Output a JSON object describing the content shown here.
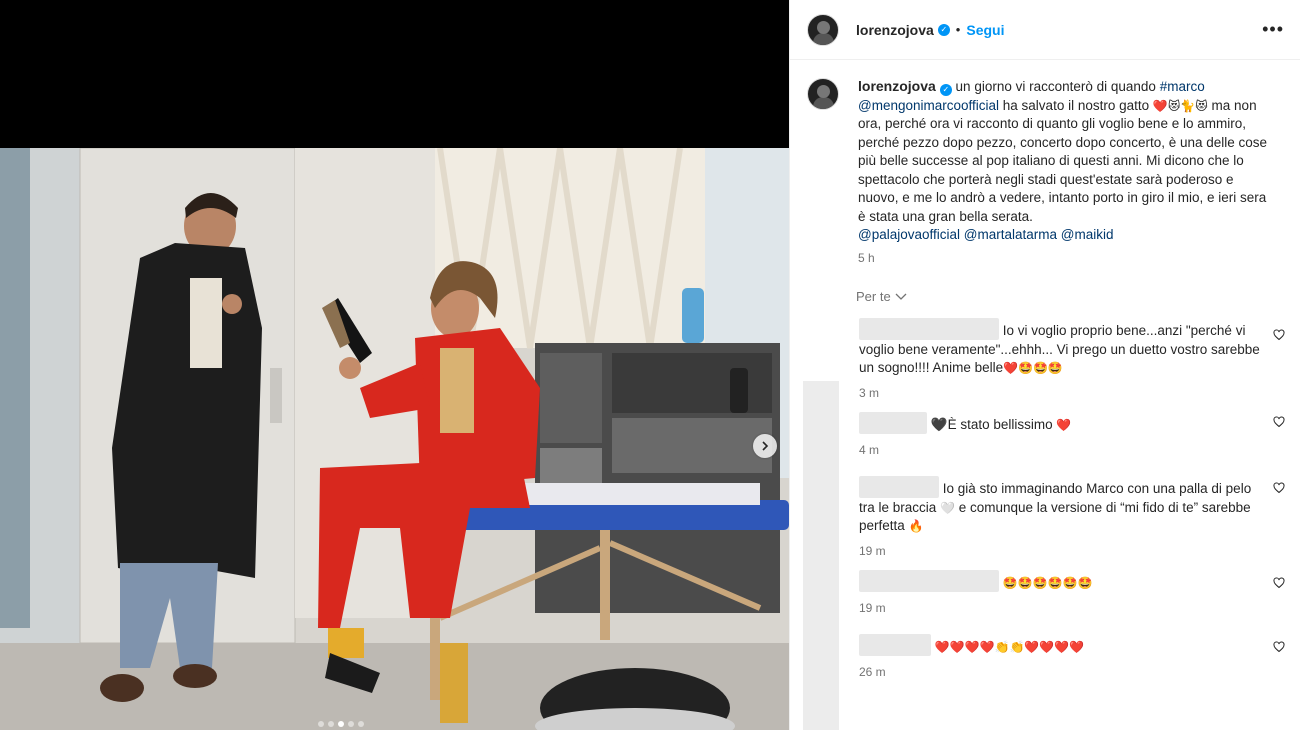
{
  "post": {
    "username": "lorenzojova",
    "follow_label": "Segui",
    "separator": "•",
    "more_label": "•••",
    "caption": {
      "username": "lorenzojova",
      "text_1": " un giorno vi racconterò di quando ",
      "hashtag_marco": "#marco",
      "mention_mengoni": "@mengonimarcoofficial",
      "text_2": " ha salvato il nostro gatto ",
      "emojis_1": "❤️😻🐈😻",
      "text_3": " ma non ora, perché ora vi racconto di quanto gli voglio bene e lo ammiro, perché pezzo dopo pezzo, concerto dopo concerto, è una delle cose più belle successe al pop italiano di questi anni. Mi dicono che lo spettacolo che porterà negli stadi quest'estate sarà poderoso e nuovo, e me lo andrò a vedere, intanto porto in giro il mio, e ieri sera è stata una gran bella serata.",
      "mention_palajova": "@palajovaofficial",
      "mention_martalatarma": "@martalatarma",
      "mention_maikid": "@maikid",
      "time": "5 h"
    },
    "per_te_label": "Per te"
  },
  "comments": [
    {
      "text": "Io vi voglio proprio bene...anzi \"perché vi voglio bene veramente\"...ehhh... Vi prego un duetto vostro sarebbe un sogno!!!! Anime belle",
      "emojis": "❤️🤩🤩🤩",
      "time": "3 m"
    },
    {
      "text": "🖤È stato bellissimo ",
      "emojis": "❤️",
      "time": "4 m"
    },
    {
      "text": "Io già sto immaginando Marco con una palla di pelo tra le braccia ",
      "emojis_mid": "🤍",
      "text_2": " e comunque la versione di “mi fido di te” sarebbe perfetta ",
      "emojis": "🔥",
      "time": "19 m"
    },
    {
      "text": "",
      "emojis": "🤩🤩🤩🤩🤩🤩",
      "time": "19 m"
    },
    {
      "text": "",
      "emojis": "❤️❤️❤️❤️👏👏❤️❤️❤️❤️",
      "time": "26 m"
    }
  ],
  "carousel": {
    "slides": 5,
    "active_index": 2
  },
  "icons": {
    "next": "chevron-right-icon",
    "verified": "verified-badge-icon",
    "like": "heart-outline-icon",
    "more": "more-options-icon",
    "dropdown": "chevron-down-icon"
  },
  "colors": {
    "accent": "#0095f6",
    "link": "#00376b",
    "secondary_text": "#737373"
  }
}
